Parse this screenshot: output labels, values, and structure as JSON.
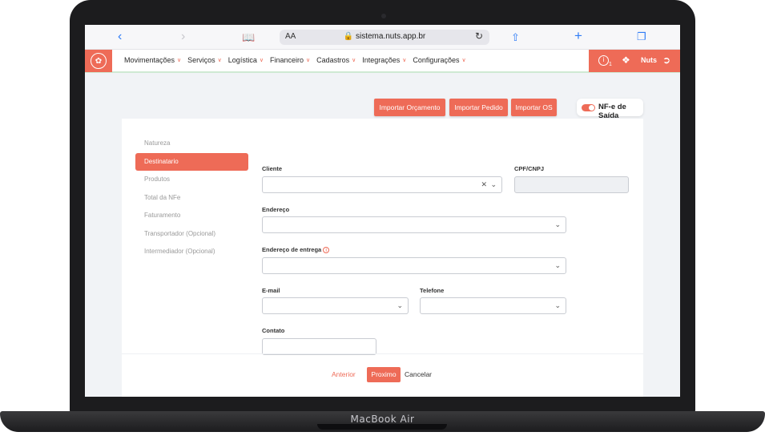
{
  "device": {
    "label": "MacBook Air"
  },
  "browser": {
    "url": "sistema.nuts.app.br",
    "text_size": "AA",
    "icons": [
      "back-icon",
      "forward-icon",
      "book-icon",
      "lock-icon",
      "reload-icon",
      "share-icon",
      "plus-icon",
      "tabs-icon"
    ]
  },
  "nav": {
    "items": [
      {
        "label": "Movimentações"
      },
      {
        "label": "Serviços"
      },
      {
        "label": "Logística"
      },
      {
        "label": "Financeiro"
      },
      {
        "label": "Cadastros"
      },
      {
        "label": "Integrações"
      },
      {
        "label": "Configurações"
      }
    ],
    "notification_count": "1",
    "user": "Nuts"
  },
  "actions": {
    "import_quote": "Importar Orçamento",
    "import_order": "Importar Pedido",
    "import_os": "Importar OS",
    "toggle_label": "NF-e de Saída"
  },
  "steps": [
    {
      "label": "Natureza"
    },
    {
      "label": "Destinatario"
    },
    {
      "label": "Produtos"
    },
    {
      "label": "Total da NFe"
    },
    {
      "label": "Faturamento"
    },
    {
      "label": "Transportador (Opcional)"
    },
    {
      "label": "Intermediador (Opcional)"
    }
  ],
  "form": {
    "cliente_label": "Cliente",
    "cpf_label": "CPF/CNPJ",
    "endereco_label": "Endereço",
    "entrega_label": "Endereço de entrega",
    "email_label": "E-mail",
    "telefone_label": "Telefone",
    "contato_label": "Contato"
  },
  "footer": {
    "prev": "Anterior",
    "next": "Proximo",
    "cancel": "Cancelar"
  },
  "colors": {
    "accent": "#ee6b57",
    "nav_border": "#cfe9d3"
  }
}
